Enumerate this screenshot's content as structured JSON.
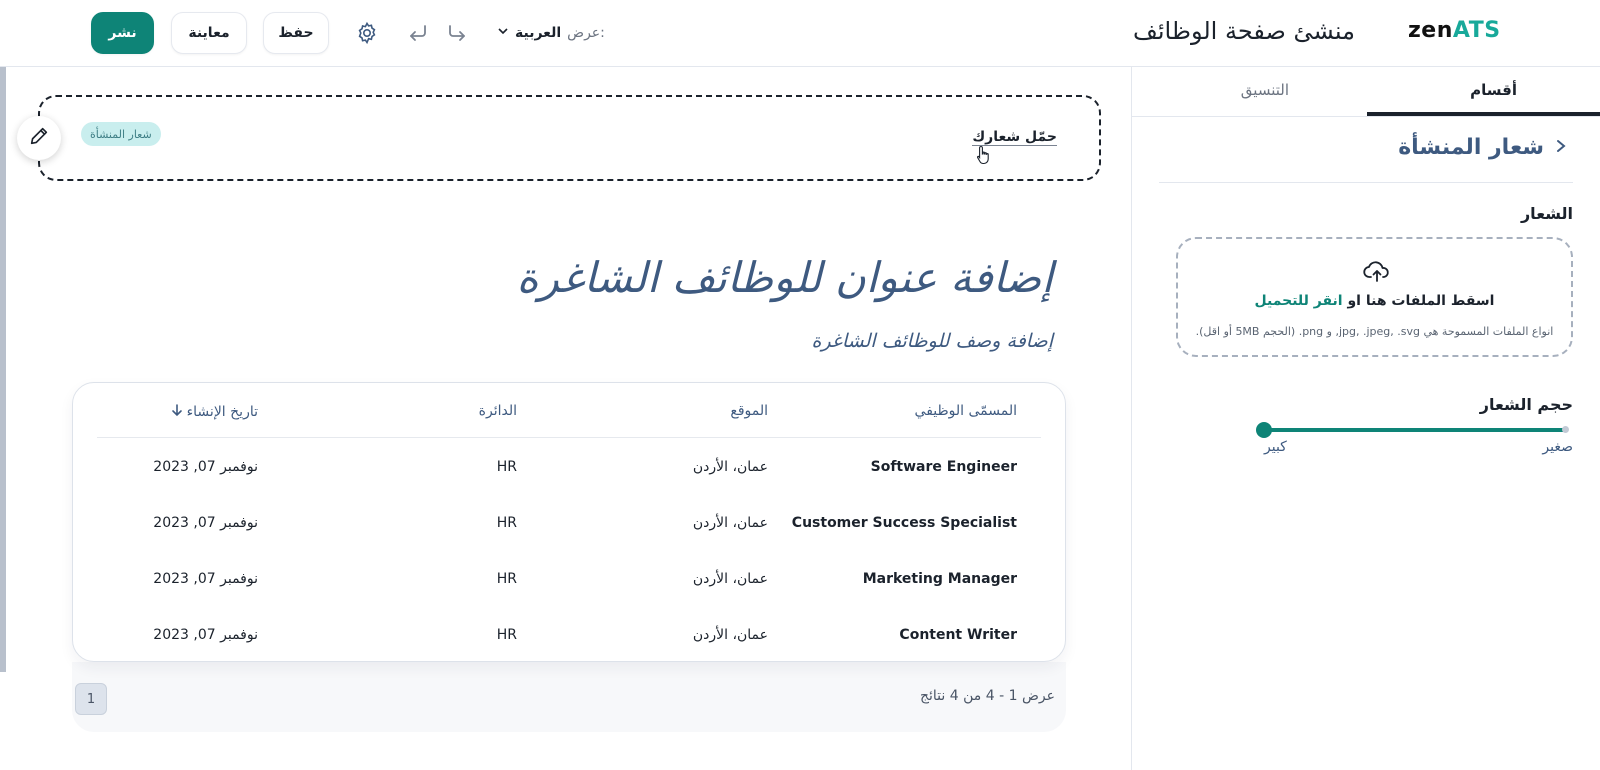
{
  "header": {
    "logo_main": "zen",
    "logo_accent": "ATS",
    "app_title": "منشئ صفحة الوظائف",
    "publish_label": "نشر",
    "preview_label": "معاينة",
    "save_label": "حفظ",
    "view_label": "عرض:",
    "view_language": "العربية"
  },
  "canvas": {
    "upload_logo_link": "حمّل شعارك",
    "logo_badge": "شعار المنشأة",
    "jobs_title": "إضافة عنوان للوظائف الشاغرة",
    "jobs_subtitle": "إضافة وصف للوظائف الشاغرة",
    "table": {
      "columns": [
        "المسمّى الوظيفي",
        "الموقع",
        "الدائرة",
        "تاريخ الإنشاء"
      ],
      "sort_icon": "arrow-down-icon",
      "rows": [
        {
          "title": "Software Engineer",
          "location": "عمان، الأردن",
          "department": "HR",
          "created": "نوفمبر 07, 2023"
        },
        {
          "title": "Customer Success Specialist",
          "location": "عمان، الأردن",
          "department": "HR",
          "created": "نوفمبر 07, 2023"
        },
        {
          "title": "Marketing Manager",
          "location": "عمان، الأردن",
          "department": "HR",
          "created": "نوفمبر 07, 2023"
        },
        {
          "title": "Content Writer",
          "location": "عمان، الأردن",
          "department": "HR",
          "created": "نوفمبر 07, 2023"
        }
      ]
    },
    "results_text": "عرض 1 - 4 من 4 نتائج",
    "current_page": "1"
  },
  "panel": {
    "tab_sections": "أقسام",
    "tab_layout": "التنسيق",
    "section_title": "شعار المنشأة",
    "logo_label": "الشعار",
    "drop_text": "اسقط الملفات هنا او",
    "drop_link": "انقر للتحميل",
    "drop_hint": "انواع الملفات المسموحة هي jpg, .jpeg, .svg, و png. (الحجم 5MB أو اقل).",
    "size_label": "حجم الشعار",
    "size_small": "صغير",
    "size_large": "كبير",
    "size_value": 1.0
  },
  "colors": {
    "accent": "#0e8477",
    "heading": "#3e5a80",
    "badge_bg": "#c9eeee"
  }
}
